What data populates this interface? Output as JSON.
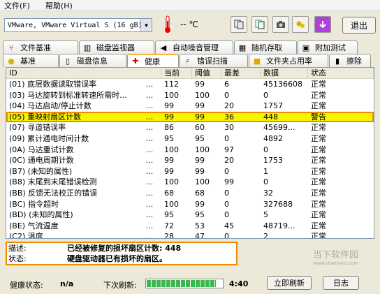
{
  "menu": {
    "file": "文件(F)",
    "help": "帮助(H)"
  },
  "toolbar": {
    "drive": "VMware, VMware Virtual S (16 gB)",
    "temperature": "-- ℃",
    "exit": "退出"
  },
  "tabs_top": [
    {
      "label": "文件基准",
      "icon": "tuning-fork-icon"
    },
    {
      "label": "磁盘监视器",
      "icon": "monitor-chart-icon"
    },
    {
      "label": "自动噪音管理",
      "icon": "speaker-icon"
    },
    {
      "label": "随机存取",
      "icon": "random-access-icon"
    },
    {
      "label": "附加测试",
      "icon": "extra-test-icon"
    }
  ],
  "tabs_bottom": [
    {
      "label": "基准",
      "icon": "lightbulb-icon"
    },
    {
      "label": "磁盘信息",
      "icon": "disk-info-icon"
    },
    {
      "label": "健康",
      "icon": "health-cross-icon",
      "active": true
    },
    {
      "label": "错误扫描",
      "icon": "magnifier-icon"
    },
    {
      "label": "文件夹占用率",
      "icon": "folder-icon"
    },
    {
      "label": "擦除",
      "icon": "trash-icon"
    }
  ],
  "columns": [
    "ID",
    "当前",
    "阈值",
    "最差",
    "数据",
    "状态"
  ],
  "rows": [
    {
      "id": "(01) 底层数据读取错误率",
      "dots": "...",
      "cur": "112",
      "thr": "99",
      "worst": "6",
      "data": "45136608",
      "status": "正常"
    },
    {
      "id": "(03) 马达旋转到标准转速所需时...",
      "dots": "...",
      "cur": "100",
      "thr": "100",
      "worst": "0",
      "data": "0",
      "status": "正常"
    },
    {
      "id": "(04) 马达启动/停止计数",
      "dots": "...",
      "cur": "99",
      "thr": "99",
      "worst": "20",
      "data": "1757",
      "status": "正常"
    },
    {
      "id": "(05) 重映射扇区计数",
      "dots": "...",
      "cur": "99",
      "thr": "99",
      "worst": "36",
      "data": "448",
      "status": "警告",
      "highlight": true
    },
    {
      "id": "(07) 寻道错误率",
      "dots": "...",
      "cur": "86",
      "thr": "60",
      "worst": "30",
      "data": "45699...",
      "status": "正常"
    },
    {
      "id": "(09) 累计通电时间计数",
      "dots": "...",
      "cur": "95",
      "thr": "95",
      "worst": "0",
      "data": "4892",
      "status": "正常"
    },
    {
      "id": "(0A) 马达重试计数",
      "dots": "...",
      "cur": "100",
      "thr": "100",
      "worst": "97",
      "data": "0",
      "status": "正常"
    },
    {
      "id": "(0C) 通电周期计数",
      "dots": "...",
      "cur": "99",
      "thr": "99",
      "worst": "20",
      "data": "1753",
      "status": "正常"
    },
    {
      "id": "(B7) (未知的属性)",
      "dots": "...",
      "cur": "99",
      "thr": "99",
      "worst": "0",
      "data": "1",
      "status": "正常"
    },
    {
      "id": "(B8) 末尾到末尾错误检测",
      "dots": "...",
      "cur": "100",
      "thr": "100",
      "worst": "99",
      "data": "0",
      "status": "正常"
    },
    {
      "id": "(BB) 反馈无法校正的错误",
      "dots": "...",
      "cur": "68",
      "thr": "68",
      "worst": "0",
      "data": "32",
      "status": "正常"
    },
    {
      "id": "(BC) 指令超时",
      "dots": "...",
      "cur": "100",
      "thr": "99",
      "worst": "0",
      "data": "327688",
      "status": "正常"
    },
    {
      "id": "(BD) (未知的属性)",
      "dots": "...",
      "cur": "95",
      "thr": "95",
      "worst": "0",
      "data": "5",
      "status": "正常"
    },
    {
      "id": "(BE) 气流温度",
      "dots": "...",
      "cur": "72",
      "thr": "53",
      "worst": "45",
      "data": "48719...",
      "status": "正常"
    },
    {
      "id": "(C2) 温度",
      "dots": "...",
      "cur": "28",
      "thr": "47",
      "worst": "0",
      "data": "2",
      "status": "正常"
    }
  ],
  "description": {
    "desc_label": "描述:",
    "desc_value": "已经被修复的损坏扇区计数: 448",
    "state_label": "状态:",
    "state_value": "硬盘驱动器已有损坏的扇区。"
  },
  "statusbar": {
    "health_label": "健康状态:",
    "health_value": "n/a",
    "next_refresh_label": "下次刷新:",
    "refresh_progress": 0.92,
    "timer": "4:40",
    "refresh_now": "立即刷新",
    "log": "日志"
  },
  "watermark": {
    "text": "当下软件园",
    "sub": "www.downxia.com"
  },
  "colors": {
    "highlight_outline": "#f08a00",
    "highlight_fill": "#f6f400",
    "warning": "#000000"
  }
}
